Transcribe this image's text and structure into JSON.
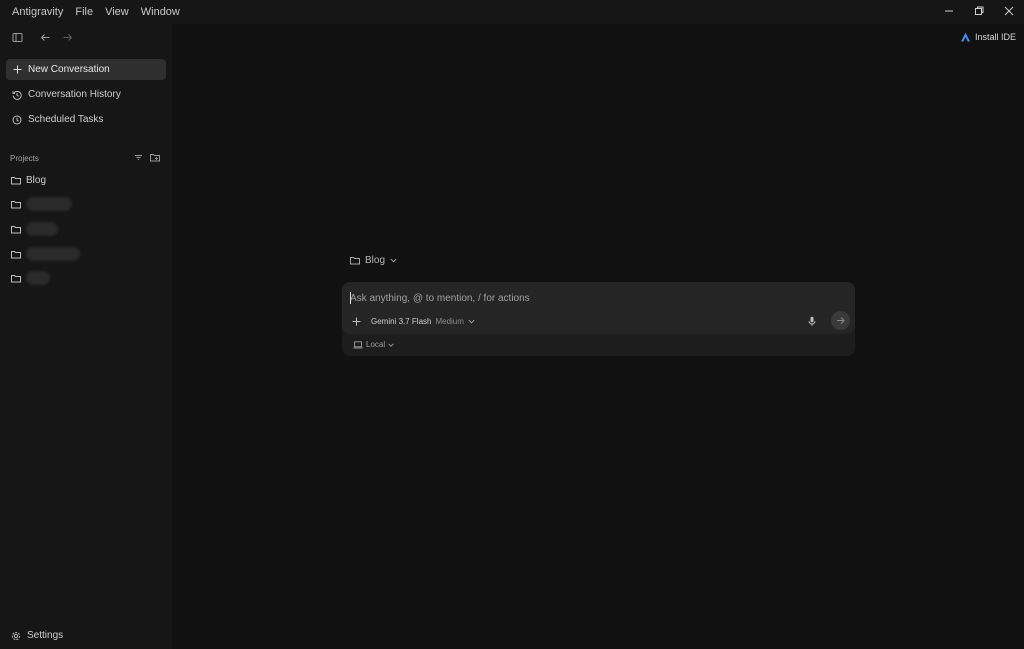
{
  "menu": {
    "items": [
      "Antigravity",
      "File",
      "View",
      "Window"
    ]
  },
  "window_controls": {
    "icons": [
      "minimize-icon",
      "restore-icon",
      "close-icon"
    ]
  },
  "sidebar": {
    "nav": [
      {
        "label": "New Conversation",
        "icon": "plus-icon",
        "active": true
      },
      {
        "label": "Conversation History",
        "icon": "history-icon",
        "active": false
      },
      {
        "label": "Scheduled Tasks",
        "icon": "clock-icon",
        "active": false
      }
    ],
    "projects_label": "Projects",
    "projects": [
      {
        "label": "Blog"
      },
      {
        "label": ""
      },
      {
        "label": ""
      },
      {
        "label": ""
      },
      {
        "label": ""
      }
    ],
    "settings_label": "Settings"
  },
  "header": {
    "install_ide_label": "Install IDE"
  },
  "composer": {
    "project": "Blog",
    "placeholder": "Ask anything, @ to mention, / for actions",
    "model_name": "Gemini 3.7 Flash",
    "model_variant": "Medium",
    "environment": "Local"
  },
  "colors": {
    "background": "#111111",
    "sidebar": "#161616",
    "active_item": "#2f2f2f",
    "composer": "#252525"
  }
}
